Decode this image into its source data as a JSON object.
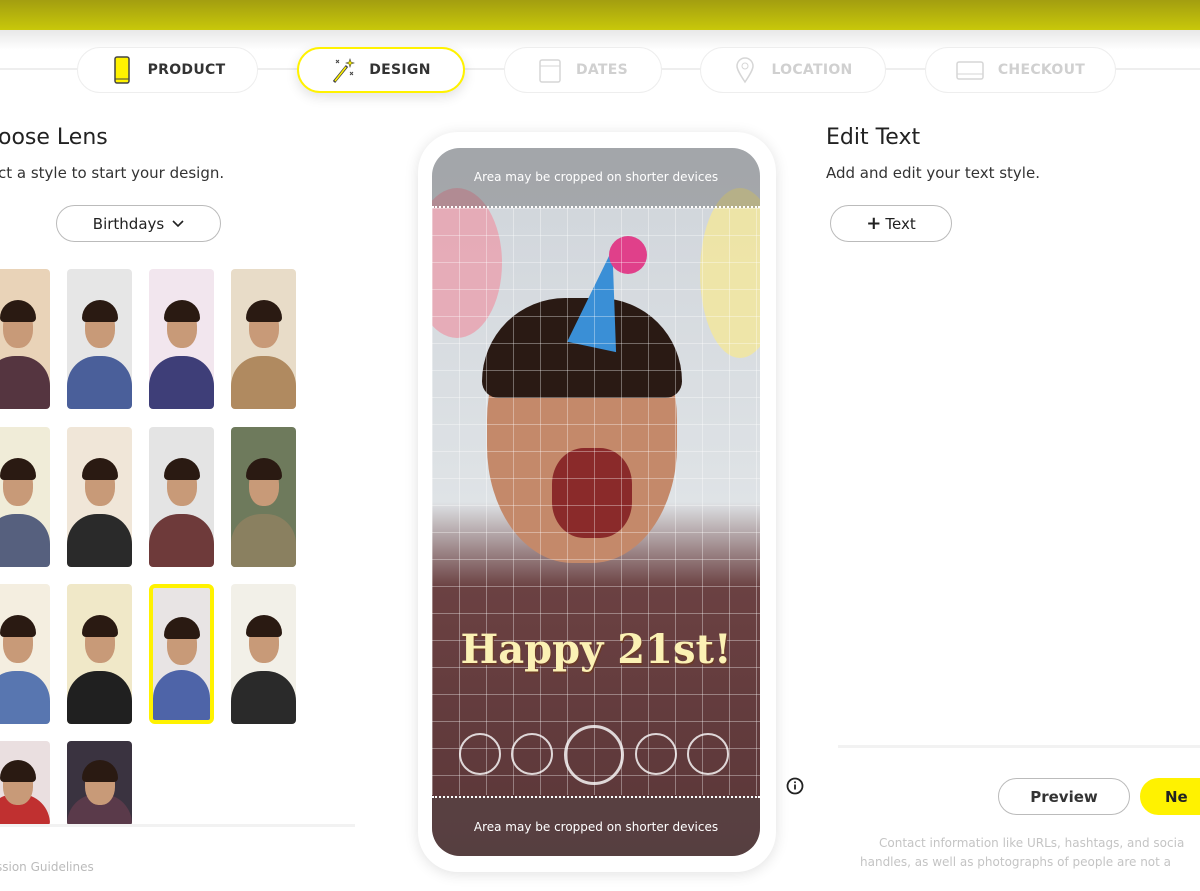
{
  "steps": [
    {
      "label": "PRODUCT",
      "icon": "phone-icon",
      "state": "done"
    },
    {
      "label": "DESIGN",
      "icon": "magic-wand-icon",
      "state": "active"
    },
    {
      "label": "DATES",
      "icon": "calendar-icon",
      "state": "disabled"
    },
    {
      "label": "LOCATION",
      "icon": "location-pin-icon",
      "state": "disabled"
    },
    {
      "label": "CHECKOUT",
      "icon": "credit-card-icon",
      "state": "disabled"
    }
  ],
  "left": {
    "title": "oose Lens",
    "subtitle": "ct a style to start your design.",
    "category": "Birthdays",
    "footer_link": "ssion Guidelines",
    "selected_lens_index": 10
  },
  "preview": {
    "crop_top": "Area may be cropped on shorter devices",
    "crop_bottom": "Area may be cropped on shorter devices",
    "overlay_text": "Happy 21st!"
  },
  "right": {
    "title": "Edit Text",
    "subtitle": "Add and edit your text style.",
    "add_text": "Text",
    "preview_button": "Preview",
    "next_button": "Ne",
    "disclaimer_line1": "Contact information like URLs, hashtags, and socia",
    "disclaimer_line2": "handles, as well as photographs of people are not a"
  },
  "colors": {
    "accent": "#fff200",
    "topbar": "#c8c80a"
  }
}
